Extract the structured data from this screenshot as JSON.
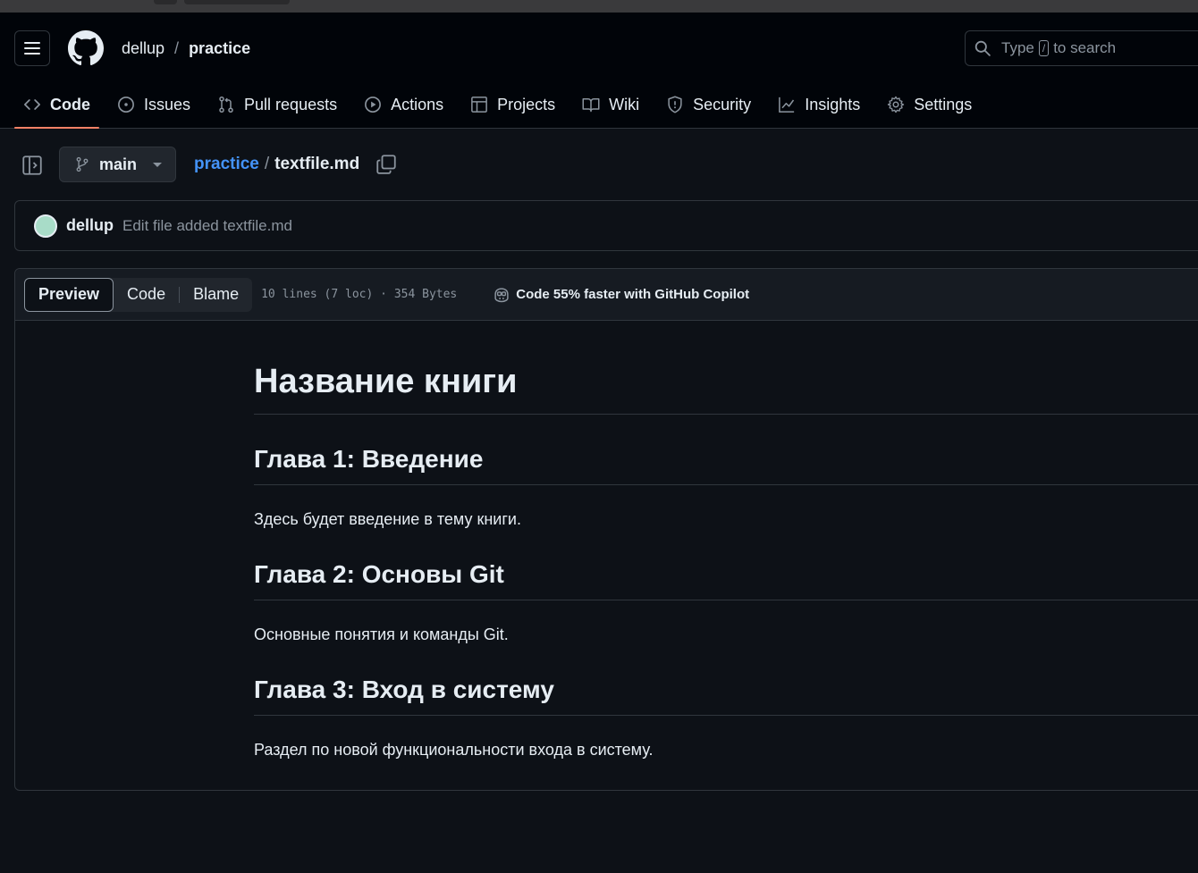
{
  "header": {
    "owner": "dellup",
    "separator": "/",
    "repo": "practice",
    "search": {
      "prefix": "Type",
      "key": "/",
      "suffix": "to search"
    }
  },
  "nav": {
    "items": [
      {
        "label": "Code",
        "icon": "code-icon",
        "active": true
      },
      {
        "label": "Issues",
        "icon": "issue-opened-icon"
      },
      {
        "label": "Pull requests",
        "icon": "git-pull-request-icon"
      },
      {
        "label": "Actions",
        "icon": "play-icon"
      },
      {
        "label": "Projects",
        "icon": "table-icon"
      },
      {
        "label": "Wiki",
        "icon": "book-icon"
      },
      {
        "label": "Security",
        "icon": "shield-icon"
      },
      {
        "label": "Insights",
        "icon": "graph-icon"
      },
      {
        "label": "Settings",
        "icon": "gear-icon"
      }
    ]
  },
  "file": {
    "branch": "main",
    "repo_link": "practice",
    "path_sep": "/",
    "filename": "textfile.md"
  },
  "commit": {
    "author": "dellup",
    "message": "Edit file added textfile.md"
  },
  "toolbar": {
    "preview": "Preview",
    "code": "Code",
    "blame": "Blame",
    "meta": "10 lines (7 loc) · 354 Bytes",
    "copilot": "Code 55% faster with GitHub Copilot"
  },
  "markdown": {
    "h1": "Название книги",
    "sections": [
      {
        "heading": "Глава 1: Введение",
        "text": "Здесь будет введение в тему книги."
      },
      {
        "heading": "Глава 2: Основы Git",
        "text": "Основные понятия и команды Git."
      },
      {
        "heading": "Глава 3: Вход в систему",
        "text": "Раздел по новой функциональности входа в систему."
      }
    ]
  },
  "colors": {
    "background": "#0d1117",
    "header_bg": "#010409",
    "accent_link": "#4493f8",
    "active_underline": "#f78166",
    "border": "#30363d"
  }
}
